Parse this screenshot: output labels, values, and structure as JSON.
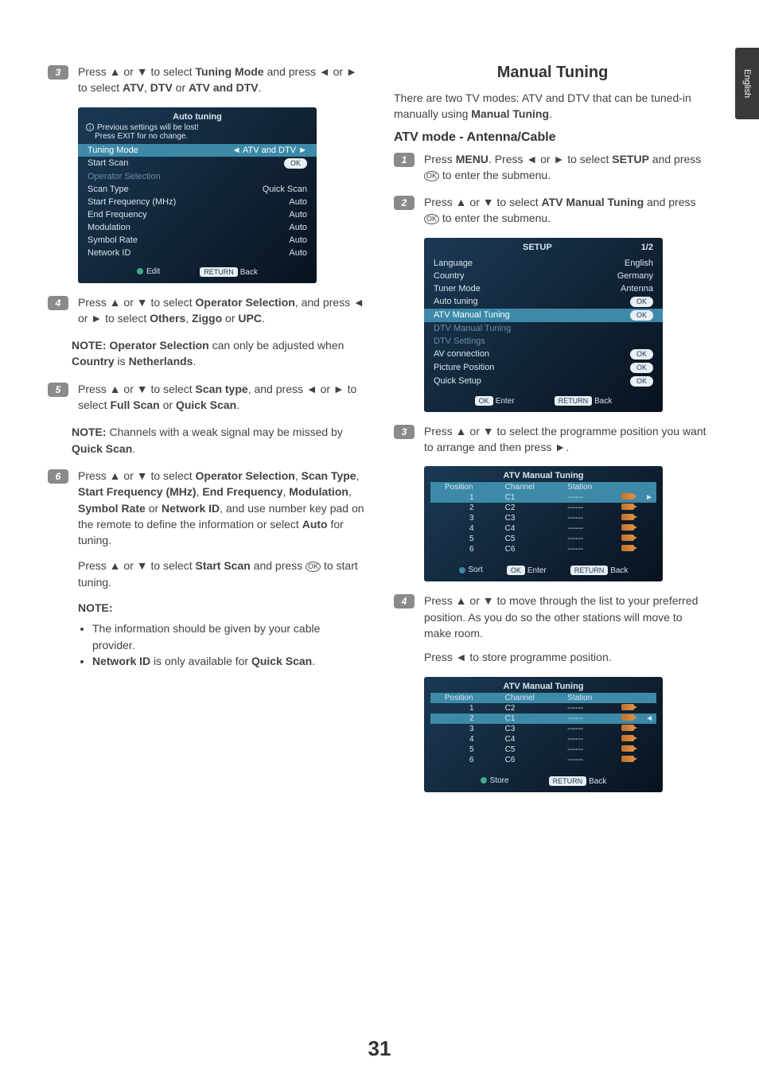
{
  "sidetab": "English",
  "page_number": "31",
  "left": {
    "step3": {
      "text_a": "Press ▲ or ▼ to select ",
      "b1": "Tuning Mode",
      "text_b": " and press ◄ or ► to select ",
      "b2": "ATV",
      "comma": ", ",
      "b3": "DTV",
      "or": " or ",
      "b4": "ATV and DTV",
      "period": "."
    },
    "osd1": {
      "title": "Auto tuning",
      "warn1": "Previous settings will be lost!",
      "warn2": "Press EXIT for no change.",
      "rows": [
        {
          "l": "Tuning Mode",
          "r": "◄   ATV and DTV   ►",
          "hl": true
        },
        {
          "l": "Start Scan",
          "r": "OK",
          "pill": true
        },
        {
          "l": "Operator Selection",
          "r": "",
          "dim": true
        },
        {
          "l": "Scan Type",
          "r": "Quick Scan"
        },
        {
          "l": "Start Frequency (MHz)",
          "r": "Auto"
        },
        {
          "l": "End Frequency",
          "r": "Auto"
        },
        {
          "l": "Modulation",
          "r": "Auto"
        },
        {
          "l": "Symbol Rate",
          "r": "Auto"
        },
        {
          "l": "Network ID",
          "r": "Auto"
        }
      ],
      "foot_edit": "Edit",
      "foot_back": "Back",
      "foot_return": "RETURN"
    },
    "step4": {
      "a": "Press ▲ or ▼ to select ",
      "b1": "Operator Selection",
      "b": ", and press ◄ or ► to select ",
      "b2": "Others",
      "c": ", ",
      "b3": "Ziggo",
      "d": " or ",
      "b4": "UPC",
      "e": "."
    },
    "note4": {
      "l": "NOTE: ",
      "b1": "Operator Selection",
      "m": " can only be adjusted when ",
      "b2": "Country",
      "n": " is ",
      "b3": "Netherlands",
      "p": "."
    },
    "step5": {
      "a": "Press ▲ or ▼ to select ",
      "b1": "Scan type",
      "b": ", and press ◄ or ► to select ",
      "b2": "Full Scan",
      "c": " or ",
      "b3": "Quick Scan",
      "d": "."
    },
    "note5": {
      "l": "NOTE:",
      "m": " Channels with a weak signal may be missed by ",
      "b1": "Quick Scan",
      "p": "."
    },
    "step6_p1": {
      "a": "Press ▲ or ▼ to select ",
      "b1": "Operator Selection",
      "c": ", ",
      "b2": "Scan Type",
      "d": ", ",
      "b3": "Start Frequency (MHz)",
      "e": ", ",
      "b4": "End Frequency",
      "f": ", ",
      "b5": "Modulation",
      "g": ", ",
      "b6": "Symbol Rate",
      "h": " or ",
      "b7": "Network ID",
      "i": ", and use number key pad on the remote to define the information or select ",
      "b8": "Auto",
      "j": " for tuning."
    },
    "step6_p2": {
      "a": "Press ▲ or ▼ to select ",
      "b1": "Start Scan",
      "b": " and press ",
      "c": " to start tuning."
    },
    "note6_label": "NOTE:",
    "note6_b1": "The information should be given by your cable provider.",
    "note6_b2a": "Network ID",
    "note6_b2b": " is only available for ",
    "note6_b2c": "Quick Scan",
    "note6_b2d": "."
  },
  "right": {
    "title": "Manual Tuning",
    "intro_a": "There are two TV modes: ATV and DTV that can be tuned-in manually using ",
    "intro_b": "Manual Tuning",
    "intro_c": ".",
    "subhead": "ATV mode - Antenna/Cable",
    "step1": {
      "a": "Press ",
      "b1": "MENU",
      "b": ". Press ◄ or ► to select ",
      "b2": "SETUP",
      "c": " and press ",
      "d": " to enter  the submenu."
    },
    "step2": {
      "a": "Press ▲ or ▼ to select ",
      "b1": "ATV Manual Tuning",
      "b": " and press ",
      "c": " to enter the submenu."
    },
    "osd_setup": {
      "title": "SETUP",
      "page": "1/2",
      "rows": [
        {
          "l": "Language",
          "r": "English"
        },
        {
          "l": "Country",
          "r": "Germany"
        },
        {
          "l": "Tuner Mode",
          "r": "Antenna"
        },
        {
          "l": "Auto tuning",
          "r": "OK",
          "pill": true
        },
        {
          "l": "ATV Manual Tuning",
          "r": "OK",
          "pill": true,
          "hl": true
        },
        {
          "l": "DTV Manual Tuning",
          "r": "",
          "dim": true
        },
        {
          "l": "DTV Settings",
          "r": "",
          "dim": true
        },
        {
          "l": "AV connection",
          "r": "OK",
          "pill": true
        },
        {
          "l": "Picture Position",
          "r": "OK",
          "pill": true
        },
        {
          "l": "Quick Setup",
          "r": "OK",
          "pill": true
        }
      ],
      "foot_enter": "Enter",
      "foot_ok": "OK",
      "foot_back": "Back",
      "foot_return": "RETURN"
    },
    "step3": {
      "a": "Press ▲ or ▼ to select the programme position you want to arrange and then press ►."
    },
    "osd_atv": {
      "title": "ATV Manual Tuning",
      "headers": [
        "Position",
        "Channel",
        "Station",
        ""
      ],
      "rows": [
        {
          "p": "1",
          "c": "C1",
          "s": "------",
          "sel": true,
          "arrow": "►"
        },
        {
          "p": "2",
          "c": "C2",
          "s": "------"
        },
        {
          "p": "3",
          "c": "C3",
          "s": "------"
        },
        {
          "p": "4",
          "c": "C4",
          "s": "------"
        },
        {
          "p": "5",
          "c": "C5",
          "s": "------"
        },
        {
          "p": "6",
          "c": "C6",
          "s": "------"
        }
      ],
      "foot_sort": "Sort",
      "foot_enter": "Enter",
      "foot_ok": "OK",
      "foot_back": "Back",
      "foot_return": "RETURN"
    },
    "step4": {
      "a": "Press ▲ or ▼ to move through the list to your preferred position. As you do so the other stations will move to make room.",
      "b": "Press ◄ to store programme position."
    },
    "osd_atv2": {
      "title": "ATV Manual Tuning",
      "headers": [
        "Position",
        "Channel",
        "Station",
        ""
      ],
      "rows": [
        {
          "p": "1",
          "c": "C2",
          "s": "------"
        },
        {
          "p": "2",
          "c": "C1",
          "s": "------",
          "sel": true,
          "arrow": "◄"
        },
        {
          "p": "3",
          "c": "C3",
          "s": "------"
        },
        {
          "p": "4",
          "c": "C4",
          "s": "------"
        },
        {
          "p": "5",
          "c": "C5",
          "s": "------"
        },
        {
          "p": "6",
          "c": "C6",
          "s": "------"
        }
      ],
      "foot_store": "Store",
      "foot_back": "Back",
      "foot_return": "RETURN"
    }
  }
}
